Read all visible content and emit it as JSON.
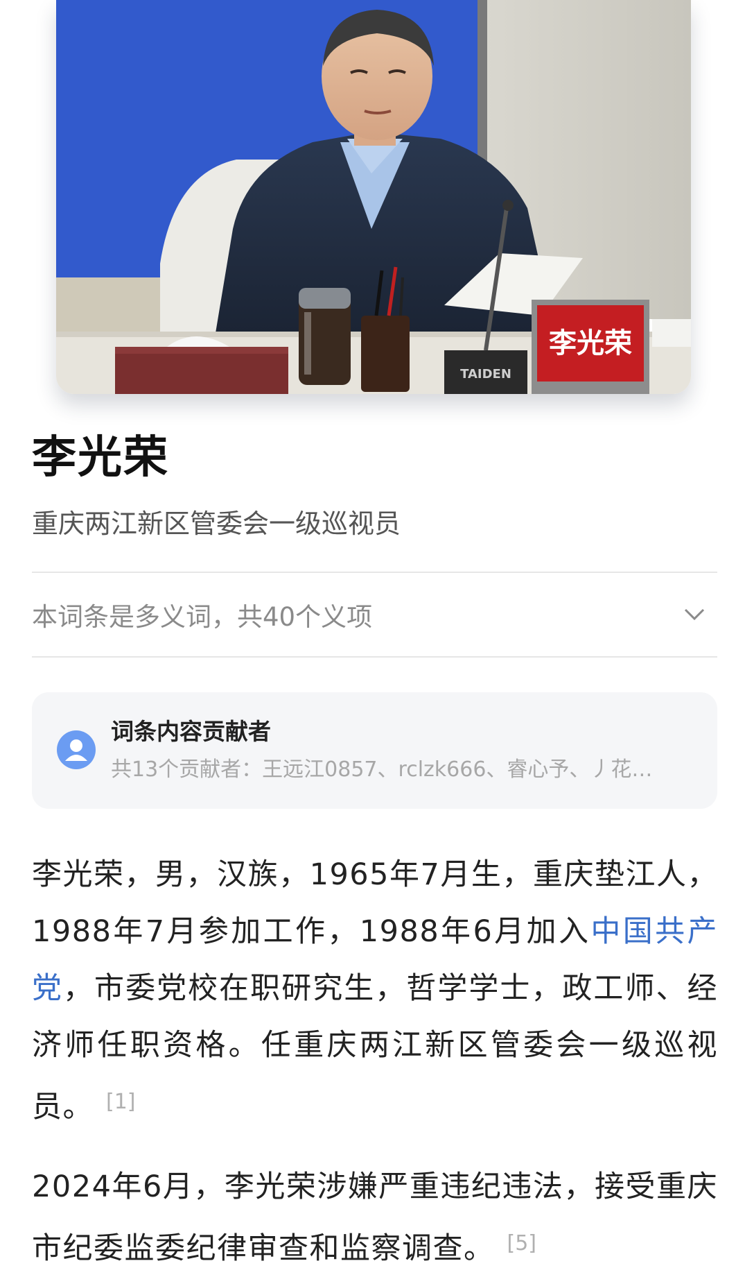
{
  "hero": {
    "nameplate_text": "李光荣",
    "mic_brand": "TAIDEN"
  },
  "entry": {
    "title": "李光荣",
    "subtitle": "重庆两江新区管委会一级巡视员"
  },
  "polysemy": {
    "text": "本词条是多义词，共40个义项"
  },
  "contributors": {
    "heading": "词条内容贡献者",
    "list": "共13个贡献者：王远江0857、rclzk666、睿心予、丿花…"
  },
  "paragraphs": [
    {
      "before_link": "李光荣，男，汉族，1965年7月生，重庆垫江人，1988年7月参加工作，1988年6月加入",
      "link": "中国共产党",
      "after_link": "，市委党校在职研究生，哲学学士，政工师、经济师任职资格。任重庆两江新区管委会一级巡视员。",
      "ref": "[1]"
    },
    {
      "text": "2024年6月，李光荣涉嫌严重违纪违法，接受重庆市纪委监委纪律审查和监察调查。",
      "ref": "[5]"
    }
  ],
  "colors": {
    "link": "#3a6fc9",
    "muted": "#8a8a8a",
    "card_bg": "#f5f6f8",
    "avatar": "#6b9cf2"
  }
}
